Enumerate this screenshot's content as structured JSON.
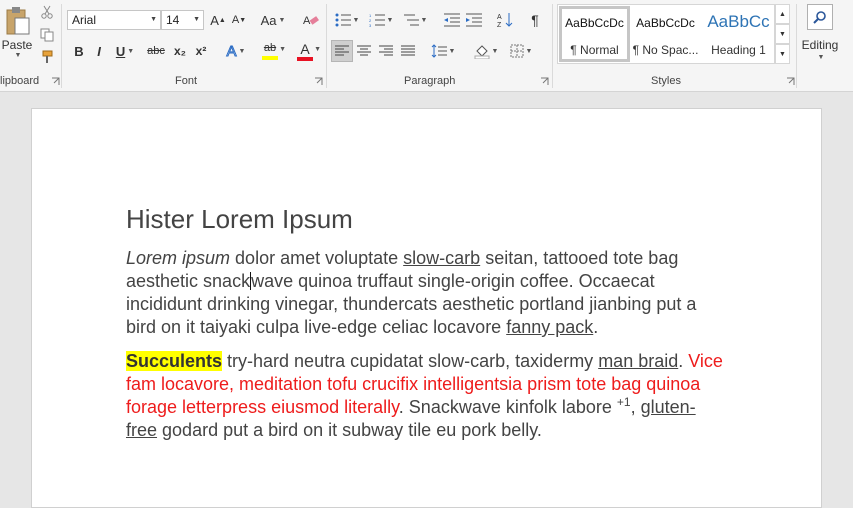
{
  "ribbon": {
    "clipboard": {
      "label": "lipboard",
      "paste_label": "Paste"
    },
    "font": {
      "label": "Font",
      "font_name": "Arial",
      "font_size": "14",
      "change_case": "Aa",
      "grow": "A",
      "shrink": "A",
      "bold": "B",
      "italic": "I",
      "underline": "U",
      "strike": "abc",
      "subscript": "x₂",
      "superscript": "x²",
      "font_color_letter": "A",
      "highlight_letters": "ab",
      "effects_letter": "A"
    },
    "paragraph": {
      "label": "Paragraph",
      "show_marks": "¶"
    },
    "styles": {
      "label": "Styles",
      "items": [
        {
          "preview": "AaBbCcDc",
          "name": "¶ Normal"
        },
        {
          "preview": "AaBbCcDc",
          "name": "¶ No Spac..."
        },
        {
          "preview": "AaBbCc",
          "name": "Heading 1"
        }
      ]
    },
    "editing": {
      "label": "Editing"
    }
  },
  "colors": {
    "font_color_bar": "#e81123",
    "highlight_bar": "#ffff00",
    "heading_style_blue": "#2e74b5",
    "red_text": "#ee1c1c",
    "accent": "#2b579a"
  },
  "document": {
    "heading": "Hister Lorem Ipsum",
    "p1": {
      "italic": "Lorem ipsum",
      "t1": " dolor amet voluptate ",
      "u1": "slow-carb",
      "t2": " seitan, tattooed tote bag aesthetic snack",
      "t3": "wave quinoa truffaut single-origin coffee. Occaecat incididunt drinking vinegar, thundercats aesthetic portland jianbing put a bird on it taiyaki culpa live-edge celiac locavore ",
      "u2": "fanny pack",
      "t4": "."
    },
    "p2": {
      "highlight": "Succulents",
      "t1": " try-hard neutra cupidatat slow-carb, taxidermy ",
      "u1": "man braid",
      "t2": ". ",
      "red": "Vice fam locavore, meditation tofu crucifix intelligentsia prism tote bag quinoa forage letterpress eiusmod literally",
      "t3": ". Snackwave kinfolk labore ",
      "sup": "+1",
      "t4": ", ",
      "u2": "gluten-free",
      "t5": " godard put a bird on it subway tile eu pork belly."
    }
  }
}
